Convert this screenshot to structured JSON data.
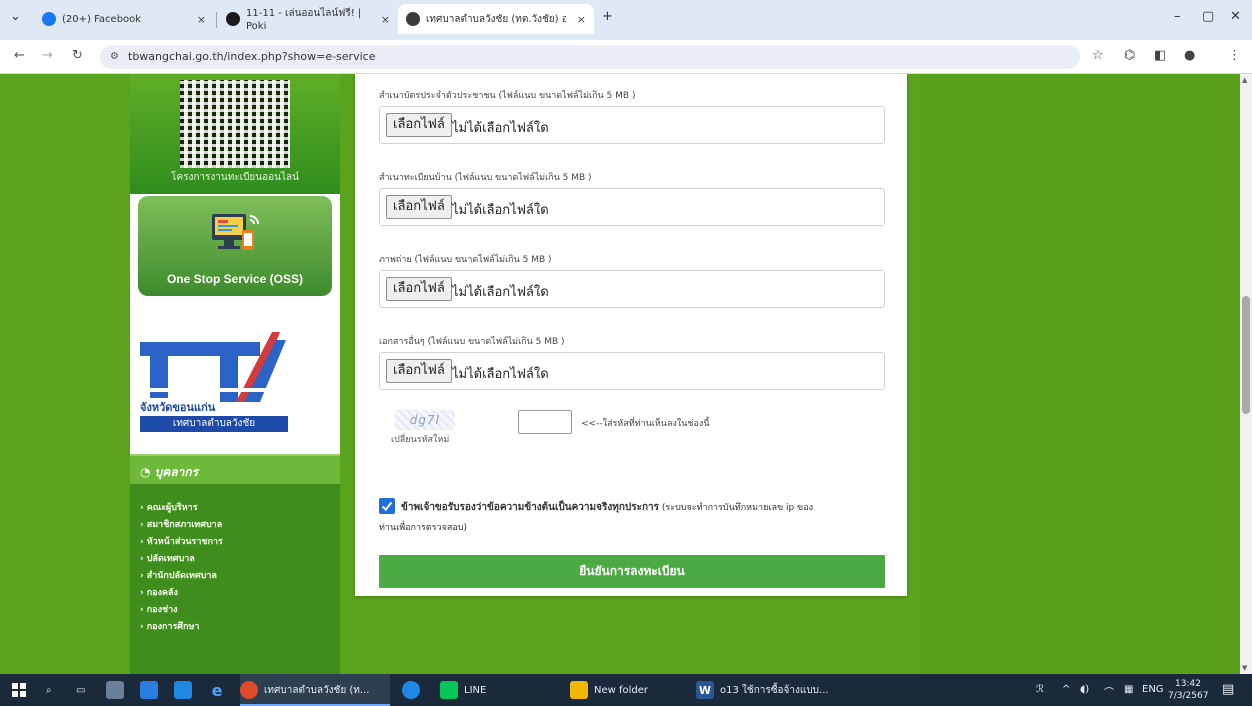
{
  "browser": {
    "tabs": [
      {
        "label": "(20+) Facebook",
        "close": "×",
        "icon_color": "#1877f2"
      },
      {
        "label": "11-11 - เล่นออนไลน์ฟรี! | Poki",
        "close": "×",
        "icon_color": "#1a1a1a"
      },
      {
        "label": "เทศบาลตำบลวังชัย (ทต.วังชัย) อ.น้ำ...",
        "close": "×",
        "icon_color": "#3b3b3b"
      }
    ],
    "new_tab": "+",
    "window_controls": {
      "minimize": "–",
      "maximize": "▢",
      "close": "✕"
    },
    "url": "tbwangchai.go.th/index.php?show=e-service"
  },
  "sidebar": {
    "qr_caption": "โครงการงานทะเบียนออนไลน์",
    "oss_label": "One Stop Service (OSS)",
    "ita_province": "จังหวัดขอนแก่น",
    "ita_org": "เทศบาลตำบลวังชัย",
    "news_heading": "บุคลากร",
    "news_items": [
      "คณะผู้บริหาร",
      "สมาชิกสภาเทศบาล",
      "หัวหน้าส่วนราชการ",
      "ปลัดเทศบาล",
      "สำนักปลัดเทศบาล",
      "กองคลัง",
      "กองช่าง",
      "กองการศึกษา"
    ]
  },
  "form": {
    "uploads": [
      {
        "label": "สำเนาบัตรประจำตัวประชาชน (ไฟล์แนบ ขนาดไฟล์ไม่เกิน 5 MB )",
        "button": "เลือกไฟล์",
        "status": "ไม่ได้เลือกไฟล์ใด"
      },
      {
        "label": "สำเนาทะเบียนบ้าน (ไฟล์แนบ ขนาดไฟล์ไม่เกิน 5 MB )",
        "button": "เลือกไฟล์",
        "status": "ไม่ได้เลือกไฟล์ใด"
      },
      {
        "label": "ภาพถ่าย (ไฟล์แนบ ขนาดไฟล์ไม่เกิน 5 MB )",
        "button": "เลือกไฟล์",
        "status": "ไม่ได้เลือกไฟล์ใด"
      },
      {
        "label": "เอกสารอื่นๆ (ไฟล์แนบ ขนาดไฟล์ไม่เกิน 5 MB )",
        "button": "เลือกไฟล์",
        "status": "ไม่ได้เลือกไฟล์ใด"
      }
    ],
    "captcha": {
      "code": "dg7I",
      "refresh": "เปลี่ยนรหัสใหม่",
      "hint": "<<--ใส่รหัสที่ท่านเห็นลงในช่องนี้",
      "value": ""
    },
    "consent": {
      "checked": true,
      "bold": "ข้าพเจ้าขอรับรองว่าข้อความข้างต้นเป็นความจริงทุกประการ",
      "note": "(ระบบจะทำการบันทึกหมายเลข ip ของ",
      "note_cont": "ท่านเพื่อการตรวจสอบ)"
    },
    "submit": "ยืนยันการลงทะเบียน"
  },
  "taskbar": {
    "items": [
      {
        "label": "เทศบาลตำบลวังชัย (ท...",
        "icon_color": "#e04a2a"
      },
      {
        "label": "",
        "icon_color": "#1e88e5"
      },
      {
        "label": "LINE",
        "icon_color": "#06c755"
      },
      {
        "label": "New folder",
        "icon_color": "#f2b705"
      },
      {
        "label": "o13 ใช้การซื้อจ้างแบบ...",
        "icon_color": "#2b579a"
      }
    ],
    "lang": "ENG",
    "time": "13:42",
    "date": "7/3/2567"
  },
  "colors": {
    "page_green": "#5aa31c",
    "submit_green": "#4caa43",
    "checkbox_blue": "#1e6fd9",
    "ita_blue": "#1d4aa8"
  }
}
